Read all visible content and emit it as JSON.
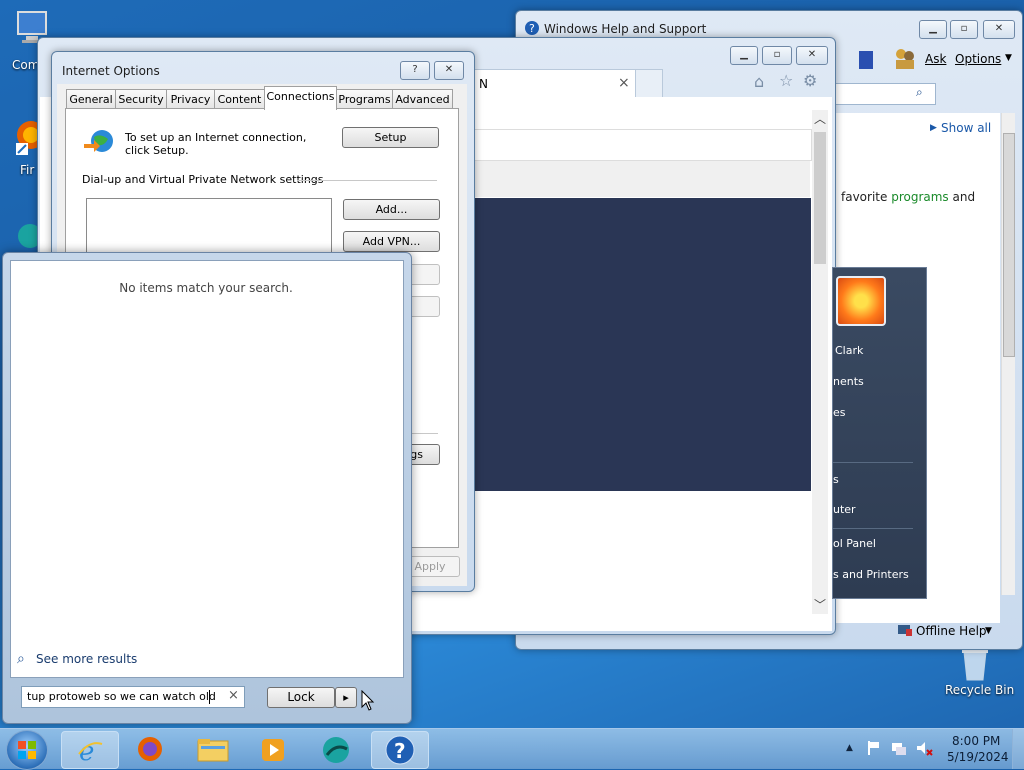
{
  "desktop": {
    "icons": [
      {
        "label": "Com"
      },
      {
        "label": "Fir"
      },
      {
        "label": "Recycle Bin"
      }
    ]
  },
  "help_window": {
    "title": "Windows Help and Support",
    "ask": "Ask",
    "options": "Options",
    "show_all": "Show all",
    "body_text_a": "favorite ",
    "body_link": "programs",
    "body_text_b": " and",
    "offline_help": "Offline Help"
  },
  "browser_window": {
    "tab_label": "N",
    "tab_close": "×"
  },
  "start_right": {
    "items": [
      "Clark",
      "nents",
      "es",
      "s",
      "uter",
      "ol Panel",
      "s and Printers"
    ]
  },
  "internet_options": {
    "title": "Internet Options",
    "help_btn": "?",
    "close_btn": "✕",
    "tabs": [
      "General",
      "Security",
      "Privacy",
      "Content",
      "Connections",
      "Programs",
      "Advanced"
    ],
    "setup_text": "To set up an Internet connection, click Setup.",
    "setup_btn": "Setup",
    "vpn_group": "Dial-up and Virtual Private Network settings",
    "add_btn": "Add...",
    "add_vpn_btn": "Add VPN...",
    "settings_btn_fragment": "gs",
    "apply_btn": "Apply"
  },
  "start_menu": {
    "no_items": "No items match your search.",
    "see_more": "See more results",
    "search_value": "tup protoweb so we can watch old",
    "clear": "×",
    "lock": "Lock",
    "arrow": "▸"
  },
  "tray": {
    "time": "8:00 PM",
    "date": "5/19/2024",
    "up_arrow": "▲"
  }
}
